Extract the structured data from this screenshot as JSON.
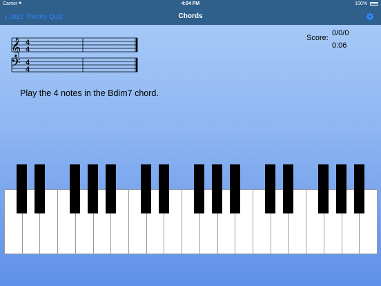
{
  "status_bar": {
    "carrier": "Carrier",
    "time": "4:04 PM",
    "battery": "100%"
  },
  "nav": {
    "back_label": "Jazz Theory Quiz",
    "title": "Chords",
    "settings_icon": "gear-icon"
  },
  "score": {
    "label": "Score:",
    "value": "0/0/0",
    "timer": "0:06"
  },
  "staff": {
    "treble_time_signature": [
      "4",
      "4"
    ],
    "bass_time_signature": [
      "4",
      "4"
    ]
  },
  "prompt": "Play the 4 notes in the Bdim7 chord.",
  "keyboard": {
    "white_keys": 21,
    "black_key_pattern": [
      1,
      1,
      0,
      1,
      1,
      1,
      0,
      1,
      1,
      0,
      1,
      1,
      1,
      0,
      1,
      1,
      0,
      1,
      1,
      1
    ]
  },
  "colors": {
    "bar": "#2f5f8b",
    "link": "#2f86ff",
    "bg_top": "#aacdf8",
    "bg_bottom": "#5f8fe8"
  }
}
